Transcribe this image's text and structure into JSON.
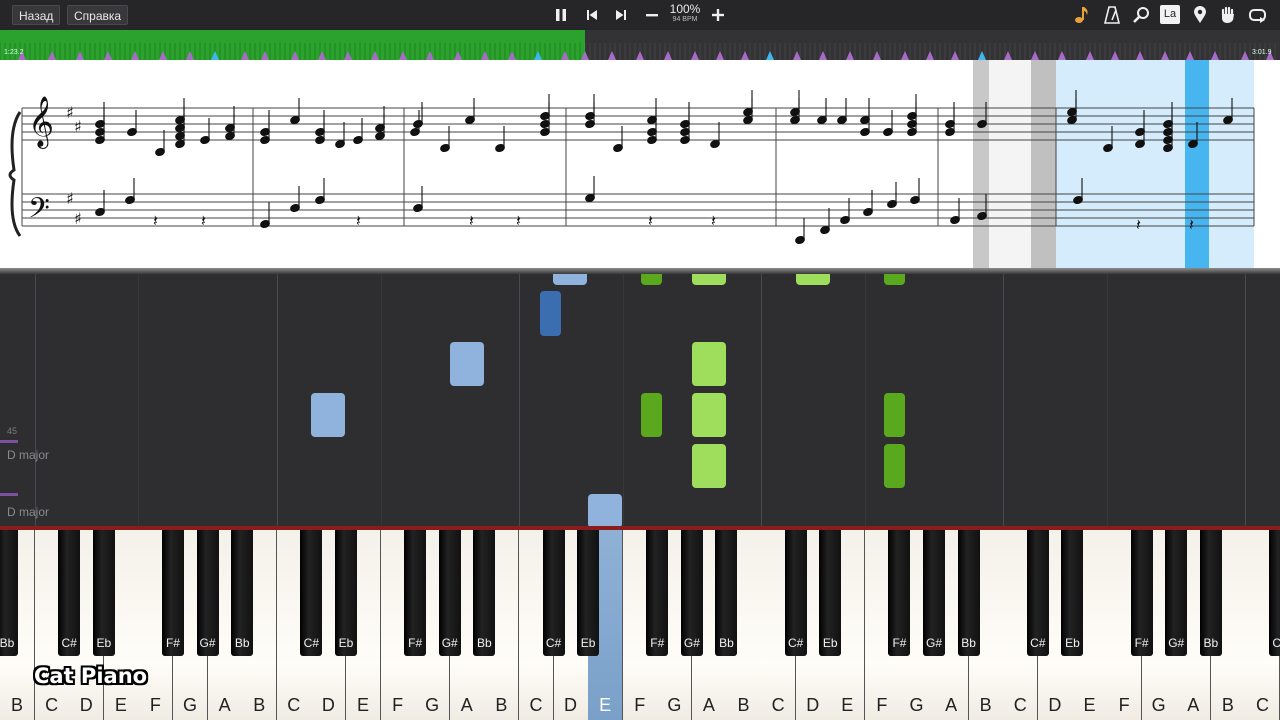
{
  "toolbar": {
    "back_label": "Назад",
    "help_label": "Справка",
    "speed_percent": "100%",
    "bpm": "94 BPM",
    "note_label_badge": "La",
    "accent_color": "#e8a23a",
    "icons": [
      "pause-icon",
      "skip-back-icon",
      "skip-forward-icon",
      "minus-icon",
      "plus-icon",
      "note-icon",
      "metronome-icon",
      "search-icon",
      "note-label-icon",
      "location-pin-icon",
      "hand-icon",
      "loop-icon"
    ]
  },
  "timeline": {
    "elapsed": "1:23.2",
    "total": "3:01.9",
    "progress_fraction": 0.457,
    "progress_color": "#2aa22c"
  },
  "falling_notes": {
    "key_signature_labels": [
      "D major",
      "D major"
    ],
    "measure_number": "45",
    "left_hand_color": "#8fb3dc",
    "left_hand_dark_color": "#3a6eb0",
    "right_hand_color": "#9ede5c",
    "right_hand_dark_color": "#5aa81e"
  },
  "keyboard": {
    "white_keys": [
      "B",
      "C",
      "D",
      "E",
      "F",
      "G",
      "A",
      "B",
      "C",
      "D",
      "E",
      "F",
      "G",
      "A",
      "B",
      "C",
      "D",
      "E",
      "F",
      "G",
      "A",
      "B",
      "C",
      "D",
      "E",
      "F",
      "G",
      "A",
      "B",
      "C",
      "D",
      "E",
      "F",
      "G",
      "A",
      "B",
      "C"
    ],
    "active_white_key_index": 17,
    "black_keys": [
      "Bb",
      "C#",
      "Eb",
      "F#",
      "G#",
      "Bb",
      "C#",
      "Eb",
      "F#",
      "G#",
      "Bb",
      "C#",
      "Eb",
      "F#",
      "G#",
      "Bb",
      "C#",
      "Eb",
      "F#",
      "G#",
      "Bb",
      "C#",
      "Eb",
      "F#",
      "G#",
      "Bb",
      "C#"
    ]
  },
  "brand": {
    "logo_text": "Cat Piano"
  }
}
